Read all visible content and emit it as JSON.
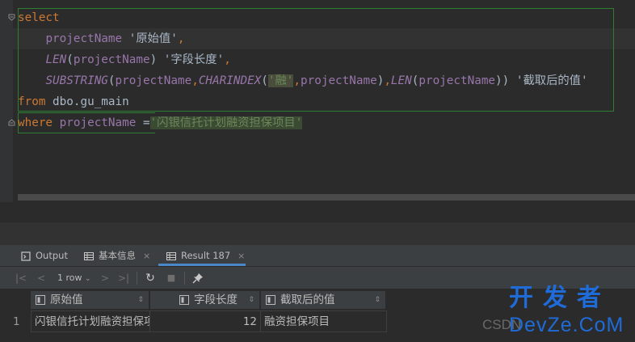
{
  "editor": {
    "lines": [
      {
        "kw": "select"
      },
      {
        "col": "projectName",
        "str": "'原始值'",
        "punc": ","
      },
      {
        "fn": "LEN",
        "open": "(",
        "col": "projectName",
        "close": ")",
        "str": "'字段长度'",
        "punc": ","
      },
      {
        "fn": "SUBSTRING",
        "open": "(",
        "col": "projectName",
        "comma1": ",",
        "fn2": "CHARINDEX",
        "open2": "(",
        "hlstr": "'融'",
        "comma2": ",",
        "col2": "projectName",
        "close2": ")",
        "comma3": ",",
        "fn3": "LEN",
        "open3": "(",
        "col3": "projectName",
        "close3": "))",
        "str": "'截取后的值'"
      },
      {
        "kw": "from",
        "rest": "dbo.gu_main"
      },
      {
        "kw": "where",
        "col": "projectName",
        "op": "=",
        "hlstr": "'闪银信托计划融资担保项目'"
      }
    ]
  },
  "tabs": [
    {
      "label": "Output",
      "icon": "output-icon"
    },
    {
      "label": "基本信息",
      "icon": "table-icon",
      "close": "×"
    },
    {
      "label": "Result 187",
      "icon": "table-icon",
      "close": "×",
      "active": true
    }
  ],
  "toolbar": {
    "first": "|<",
    "prev": "<",
    "rowcount": "1 row",
    "rowcount_arrow": "⌄",
    "next": ">",
    "last": ">|",
    "refresh": "↻",
    "stop": "■",
    "pin": "📌"
  },
  "grid": {
    "columns": [
      {
        "label": "原始值",
        "sort": "⇕"
      },
      {
        "label": "字段长度",
        "sort": "⇕"
      },
      {
        "label": "截取后的值",
        "sort": "⇕"
      }
    ],
    "rows": [
      {
        "num": "1",
        "values": [
          "闪银信托计划融资担保项目",
          "12",
          "融资担保项目"
        ]
      }
    ]
  },
  "watermark": {
    "csdn": "CSDN",
    "top": "开发者",
    "bottom": "DevZe.CoM"
  },
  "colors": {
    "keyword": "#cc7832",
    "column": "#9876aa",
    "string_highlight": "#6a8759",
    "accent": "#4a88c7",
    "watermark": "#1f6bd8"
  }
}
